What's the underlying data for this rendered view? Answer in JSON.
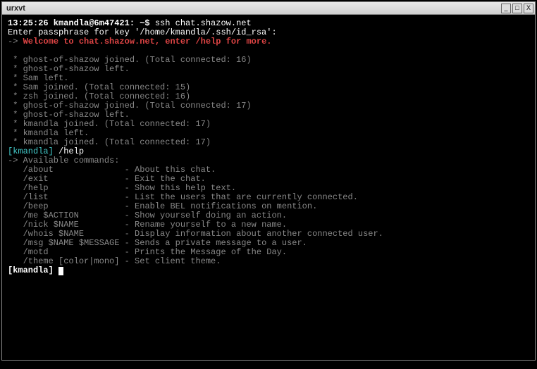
{
  "window": {
    "title": "urxvt",
    "min": "_",
    "max": "□",
    "close": "X"
  },
  "terminal": {
    "prompt_time_user": "13:25:26 kmandla@6m47421: ~$ ",
    "ssh_cmd": "ssh chat.shazow.net",
    "passphrase_line": "Enter passphrase for key '/home/kmandla/.ssh/id_rsa':",
    "welcome_prefix": "-> ",
    "welcome_msg": "Welcome to chat.shazow.net, enter /help for more.",
    "events": [
      " * ghost-of-shazow joined. (Total connected: 16)",
      " * ghost-of-shazow left.",
      " * Sam left.",
      " * Sam joined. (Total connected: 15)",
      " * zsh joined. (Total connected: 16)",
      " * ghost-of-shazow joined. (Total connected: 17)",
      " * ghost-of-shazow left.",
      " * kmandla joined. (Total connected: 17)",
      " * kmandla left.",
      " * kmandla joined. (Total connected: 17)"
    ],
    "chat_prompt_user": "[kmandla] ",
    "help_cmd": "/help",
    "help_header": "-> Available commands:",
    "help_rows": [
      {
        "cmd": "   /about              ",
        "desc": "- About this chat."
      },
      {
        "cmd": "   /exit               ",
        "desc": "- Exit the chat."
      },
      {
        "cmd": "   /help               ",
        "desc": "- Show this help text."
      },
      {
        "cmd": "   /list               ",
        "desc": "- List the users that are currently connected."
      },
      {
        "cmd": "   /beep               ",
        "desc": "- Enable BEL notifications on mention."
      },
      {
        "cmd": "   /me $ACTION         ",
        "desc": "- Show yourself doing an action."
      },
      {
        "cmd": "   /nick $NAME         ",
        "desc": "- Rename yourself to a new name."
      },
      {
        "cmd": "   /whois $NAME        ",
        "desc": "- Display information about another connected user."
      },
      {
        "cmd": "   /msg $NAME $MESSAGE ",
        "desc": "- Sends a private message to a user."
      },
      {
        "cmd": "   /motd               ",
        "desc": "- Prints the Message of the Day."
      },
      {
        "cmd": "   /theme [color|mono] ",
        "desc": "- Set client theme."
      }
    ],
    "bottom_prompt": "[kmandla] "
  }
}
